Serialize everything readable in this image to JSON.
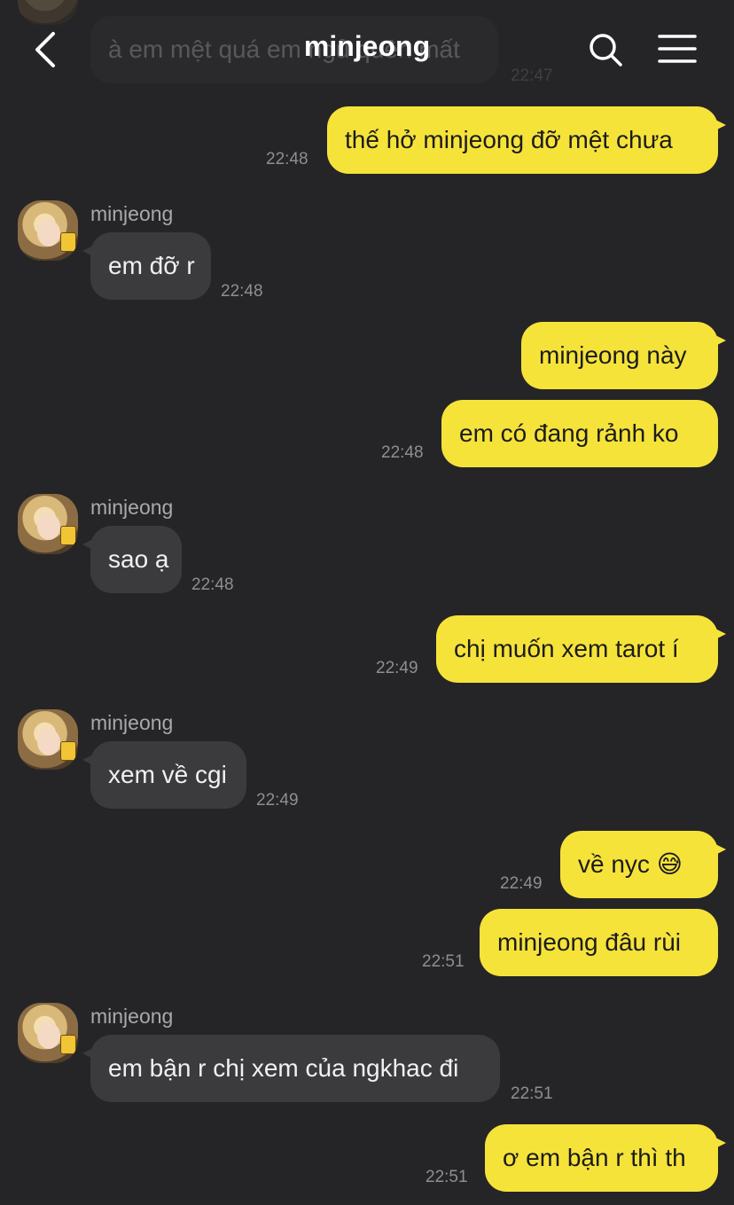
{
  "header": {
    "title": "minjeong",
    "back_icon": "chevron-left-icon",
    "search_icon": "search-icon",
    "menu_icon": "hamburger-menu-icon"
  },
  "previous_message": {
    "text": "à em mệt quá em ngủ quên mất",
    "time": "22:47"
  },
  "contact_name": "minjeong",
  "colors": {
    "background": "#252527",
    "sent_bubble": "#f6e33a",
    "received_bubble": "#3b3b3e"
  },
  "messages": [
    {
      "text": "thế hở minjeong đỡ mệt chưa",
      "time": "22:48",
      "from": "me"
    },
    {
      "sender": "minjeong",
      "text": "em đỡ r",
      "time": "22:48",
      "from": "them"
    },
    {
      "text": "minjeong này",
      "from": "me"
    },
    {
      "text": "em có đang rảnh ko",
      "time": "22:48",
      "from": "me"
    },
    {
      "sender": "minjeong",
      "text": "sao ạ",
      "time": "22:48",
      "from": "them"
    },
    {
      "text": "chị muốn xem tarot í",
      "time": "22:49",
      "from": "me"
    },
    {
      "sender": "minjeong",
      "text": "xem về cgi",
      "time": "22:49",
      "from": "them"
    },
    {
      "text": "về nyc 😅",
      "time": "22:49",
      "from": "me"
    },
    {
      "text": "minjeong đâu rùi",
      "time": "22:51",
      "from": "me"
    },
    {
      "sender": "minjeong",
      "text": "em bận r chị xem của ngkhac đi",
      "time": "22:51",
      "from": "them"
    },
    {
      "text": "ơ em bận r thì th",
      "time": "22:51",
      "from": "me"
    }
  ]
}
